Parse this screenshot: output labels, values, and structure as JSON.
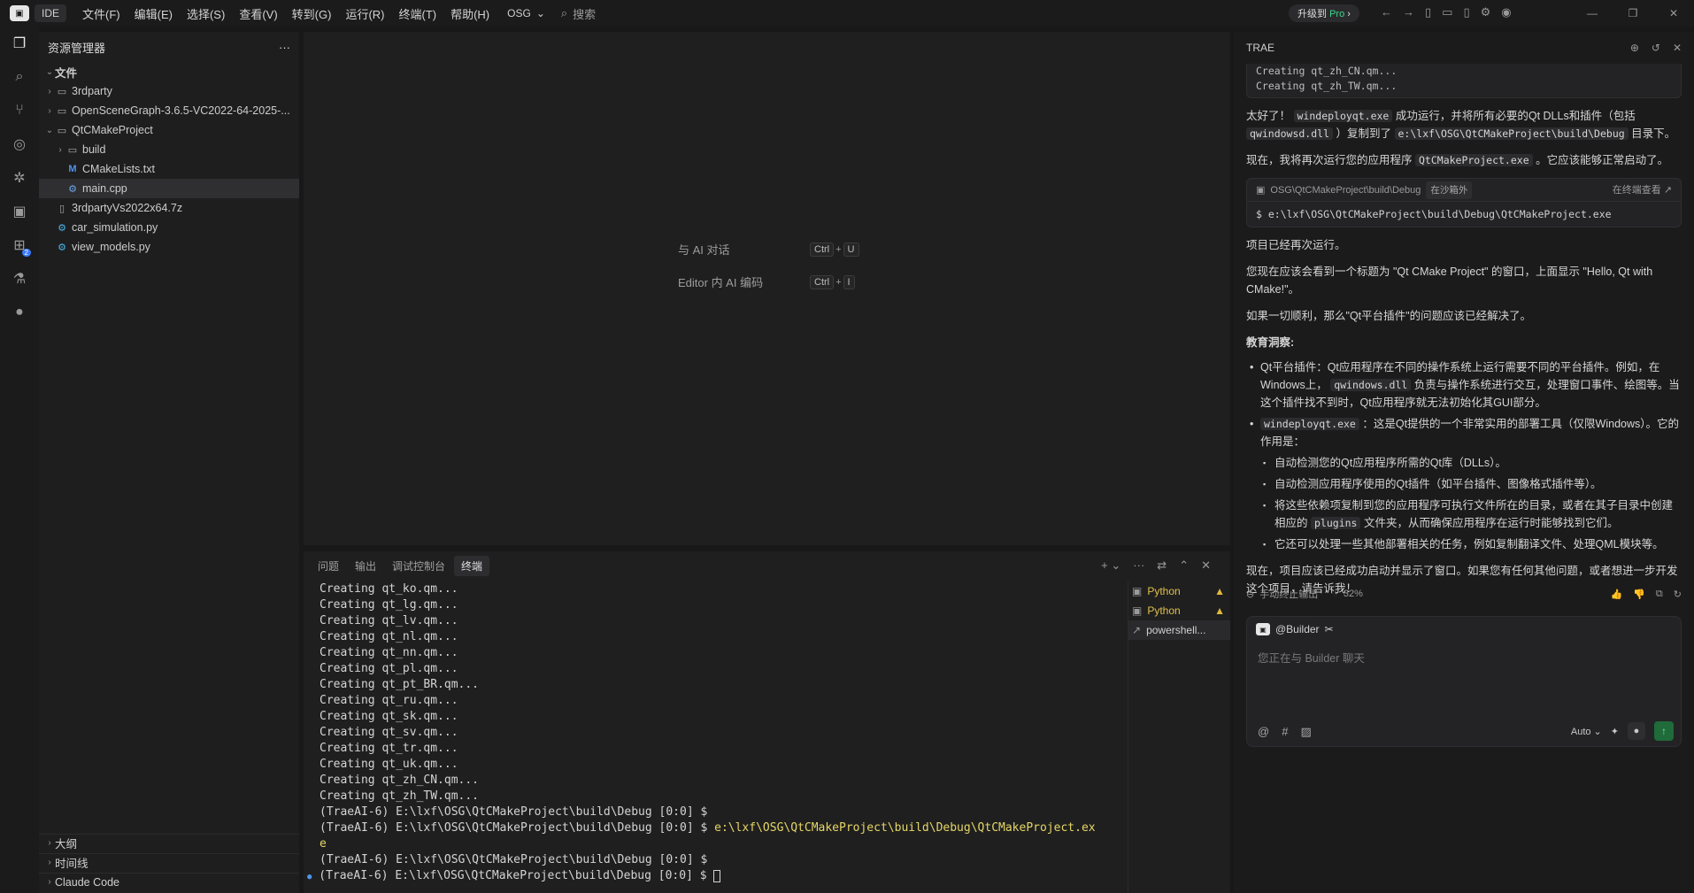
{
  "titlebar": {
    "logo": "TRAE",
    "ide_tab": "IDE",
    "menu": [
      "文件(F)",
      "编辑(E)",
      "选择(S)",
      "查看(V)",
      "转到(G)",
      "运行(R)",
      "终端(T)",
      "帮助(H)"
    ],
    "workspace": "OSG",
    "search_placeholder": "搜索",
    "upgrade_label": "升级到",
    "upgrade_pro": "Pro"
  },
  "sidebar": {
    "title": "资源管理器",
    "more": "···",
    "root": "文件",
    "items": [
      {
        "label": "3rdparty",
        "depth": 1,
        "type": "folder",
        "expanded": false
      },
      {
        "label": "OpenSceneGraph-3.6.5-VC2022-64-2025-...",
        "depth": 1,
        "type": "folder",
        "expanded": false
      },
      {
        "label": "QtCMakeProject",
        "depth": 1,
        "type": "folder",
        "expanded": true
      },
      {
        "label": "build",
        "depth": 2,
        "type": "folder",
        "expanded": false
      },
      {
        "label": "CMakeLists.txt",
        "depth": 2,
        "type": "cmake"
      },
      {
        "label": "main.cpp",
        "depth": 2,
        "type": "cpp",
        "selected": true
      },
      {
        "label": "3rdpartyVs2022x64.7z",
        "depth": 1,
        "type": "file"
      },
      {
        "label": "car_simulation.py",
        "depth": 1,
        "type": "py"
      },
      {
        "label": "view_models.py",
        "depth": 1,
        "type": "py"
      }
    ],
    "bottom_sections": [
      "大纲",
      "时间线",
      "Claude Code"
    ]
  },
  "activity": {
    "extensions_badge": "2"
  },
  "editor": {
    "hints": [
      {
        "label": "与 AI 对话",
        "keys": [
          "Ctrl",
          "U"
        ]
      },
      {
        "label": "Editor 内 AI 编码",
        "keys": [
          "Ctrl",
          "I"
        ]
      }
    ]
  },
  "panel": {
    "tabs": [
      "问题",
      "输出",
      "调试控制台",
      "终端"
    ],
    "active_tab": "终端",
    "terminal_lines": [
      "Creating qt_ko.qm...",
      "Creating qt_lg.qm...",
      "Creating qt_lv.qm...",
      "Creating qt_nl.qm...",
      "Creating qt_nn.qm...",
      "Creating qt_pl.qm...",
      "Creating qt_pt_BR.qm...",
      "Creating qt_ru.qm...",
      "Creating qt_sk.qm...",
      "Creating qt_sv.qm...",
      "Creating qt_tr.qm...",
      "Creating qt_uk.qm...",
      "Creating qt_zh_CN.qm...",
      "Creating qt_zh_TW.qm...",
      "(TraeAI-6) E:\\lxf\\OSG\\QtCMakeProject\\build\\Debug [0:0] $"
    ],
    "prompt": "(TraeAI-6) E:\\lxf\\OSG\\QtCMakeProject\\build\\Debug [0:0] $",
    "cmd_part1": "e:\\lxf\\OSG\\QtCMakeProject\\build\\Debug\\QtCMakeProject.ex",
    "cmd_part2": "e",
    "prompt_after": "(TraeAI-6) E:\\lxf\\OSG\\QtCMakeProject\\build\\Debug [0:0] $",
    "prompt_last": "(TraeAI-6) E:\\lxf\\OSG\\QtCMakeProject\\build\\Debug [0:0] $",
    "terminals": [
      {
        "label": "Python",
        "warning": true
      },
      {
        "label": "Python",
        "warning": true
      },
      {
        "label": "powershell...",
        "warning": false
      }
    ]
  },
  "chat": {
    "title": "TRAE",
    "code_tail": [
      "Creating qt_zh_CN.qm...",
      "Creating qt_zh_TW.qm..."
    ],
    "p1_a": "太好了！",
    "p1_code1": "windeployqt.exe",
    "p1_b": "成功运行，并将所有必要的Qt DLLs和插件（包括",
    "p1_code2": "qwindowsd.dll",
    "p1_c": "）复制到了",
    "p1_code3": "e:\\lxf\\OSG\\QtCMakeProject\\build\\Debug",
    "p1_d": "目录下。",
    "p2_a": "现在，我将再次运行您的应用程序",
    "p2_code": "QtCMakeProject.exe",
    "p2_b": "。它应该能够正常启动了。",
    "cmd_path": "OSG\\QtCMakeProject\\build\\Debug",
    "cmd_sandbox": "在沙箱外",
    "cmd_view": "在终端查看 ↗",
    "cmd_line": "$ e:\\lxf\\OSG\\QtCMakeProject\\build\\Debug\\QtCMakeProject.exe",
    "p3": "项目已经再次运行。",
    "p4": "您现在应该会看到一个标题为 \"Qt CMake Project\" 的窗口，上面显示 \"Hello, Qt with CMake!\"。",
    "p5": "如果一切顺利，那么\"Qt平台插件\"的问题应该已经解决了。",
    "insight_title": "教育洞察:",
    "b1_a": "Qt平台插件：Qt应用程序在不同的操作系统上运行需要不同的平台插件。例如，在Windows上，",
    "b1_code": "qwindows.dll",
    "b1_b": "负责与操作系统进行交互，处理窗口事件、绘图等。当这个插件找不到时，Qt应用程序就无法初始化其GUI部分。",
    "b2_code": "windeployqt.exe",
    "b2_a": "：这是Qt提供的一个非常实用的部署工具（仅限Windows）。它的作用是：",
    "s1": "自动检测您的Qt应用程序所需的Qt库（DLLs）。",
    "s2": "自动检测应用程序使用的Qt插件（如平台插件、图像格式插件等）。",
    "s3_a": "将这些依赖项复制到您的应用程序可执行文件所在的目录，或者在其子目录中创建相应的",
    "s3_code": "plugins",
    "s3_b": "文件夹，从而确保应用程序在运行时能够找到它们。",
    "s4": "它还可以处理一些其他部署相关的任务，例如复制翻译文件、处理QML模块等。",
    "p6": "现在，项目应该已经成功启动并显示了窗口。如果您有任何其他问题，或者想进一步开发这个项目，请告诉我！",
    "stop_label": "手动终止输出",
    "progress": "32%",
    "builder": "@Builder",
    "input_placeholder": "您正在与 Builder 聊天",
    "model": "Auto"
  }
}
